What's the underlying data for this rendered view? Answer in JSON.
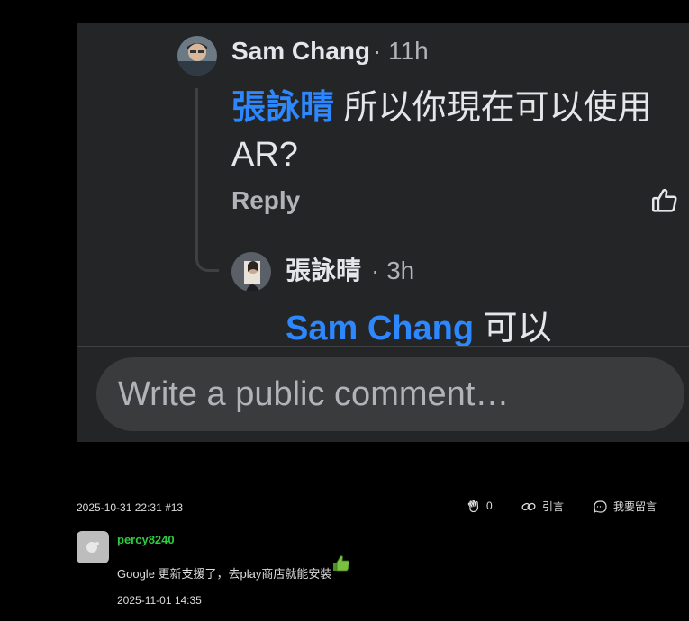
{
  "embed": {
    "comment1": {
      "author": "Sam Chang",
      "time": "· 11h",
      "mention": "張詠晴",
      "text": " 所以你現在可以使用AR?",
      "reply_label": "Reply"
    },
    "comment2": {
      "author": "張詠晴",
      "time": "· 3h",
      "mention": "Sam Chang",
      "text": " 可以"
    },
    "composer": {
      "placeholder": "Write a public comment…"
    }
  },
  "post_meta": {
    "datetime": "2025-10-31 22:31 #13",
    "like_count": "0",
    "quote_label": "引言",
    "reply_label": "我要留言"
  },
  "reply_post": {
    "username": "percy8240",
    "text": "Google 更新支援了，去play商店就能安裝",
    "datetime": "2025-11-01 14:35"
  },
  "colors": {
    "mention": "#2d88ff",
    "username": "#2ecc40",
    "embed_bg": "#242526"
  }
}
